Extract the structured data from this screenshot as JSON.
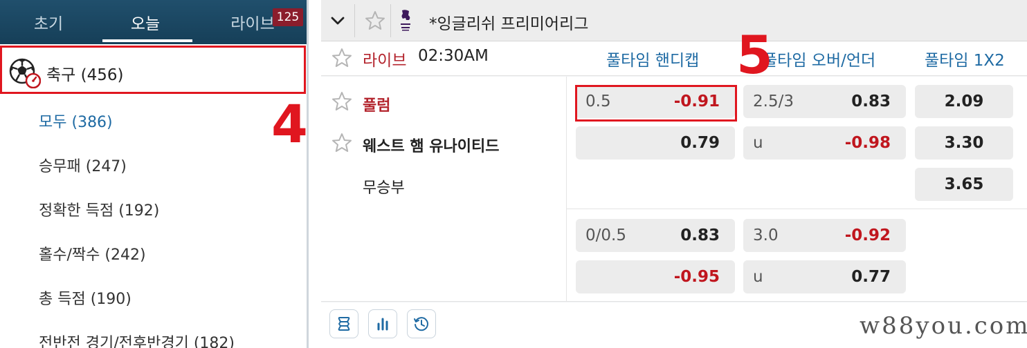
{
  "sidebar": {
    "tabs": [
      {
        "label": "초기"
      },
      {
        "label": "오늘"
      },
      {
        "label": "라이브",
        "badge": "125"
      }
    ],
    "sport": {
      "name": "축구",
      "count": "(456)",
      "icon": "soccer-ball-timer-icon"
    },
    "categories": [
      {
        "label": "모두",
        "count": "(386)"
      },
      {
        "label": "승무패",
        "count": "(247)"
      },
      {
        "label": "정확한 득점",
        "count": "(192)"
      },
      {
        "label": "홀수/짝수",
        "count": "(242)"
      },
      {
        "label": "총 득점",
        "count": "(190)"
      },
      {
        "label": "전반전 경기/전후반경기",
        "count": "(182)"
      }
    ]
  },
  "annotations": {
    "step4": "4",
    "step5": "5"
  },
  "league": {
    "name": "*잉글리쉬 프리미어리그",
    "collapse_icon": "chevron-down-icon",
    "star_icon": "star-outline-icon",
    "logo_icon": "premier-league-logo"
  },
  "match": {
    "live_label": "라이브",
    "time": "02:30AM",
    "columns": [
      "풀타임 핸디캡",
      "풀타임 오버/언더",
      "풀타임 1X2"
    ],
    "teams": {
      "home": "풀럼",
      "away": "웨스트 햄 유나이티드",
      "draw": "무승부"
    },
    "line1": {
      "handicap": {
        "home_line": "0.5",
        "home_odds": "-0.91",
        "away_odds": "0.79"
      },
      "over_under": {
        "line": "2.5/3",
        "over_odds": "0.83",
        "under_label": "u",
        "under_odds": "-0.98"
      },
      "one_x_two": {
        "home": "2.09",
        "away": "3.30",
        "draw": "3.65"
      }
    },
    "line2": {
      "handicap": {
        "home_line": "0/0.5",
        "home_odds": "0.83",
        "away_odds": "-0.95"
      },
      "over_under": {
        "line": "3.0",
        "over_odds": "-0.92",
        "under_label": "u",
        "under_odds": "0.77"
      }
    }
  },
  "footer": {
    "buttons": [
      {
        "icon": "list-layout-icon"
      },
      {
        "icon": "bar-chart-icon"
      },
      {
        "icon": "clock-history-icon"
      }
    ],
    "watermark": "w88you.com"
  },
  "colors": {
    "header_bg": "#1a4763",
    "accent_blue": "#1e6aa3",
    "live_red": "#b3232c",
    "negative_red": "#c0161e",
    "annotation_red": "#e0161f",
    "badge": "#8b1d2c"
  }
}
